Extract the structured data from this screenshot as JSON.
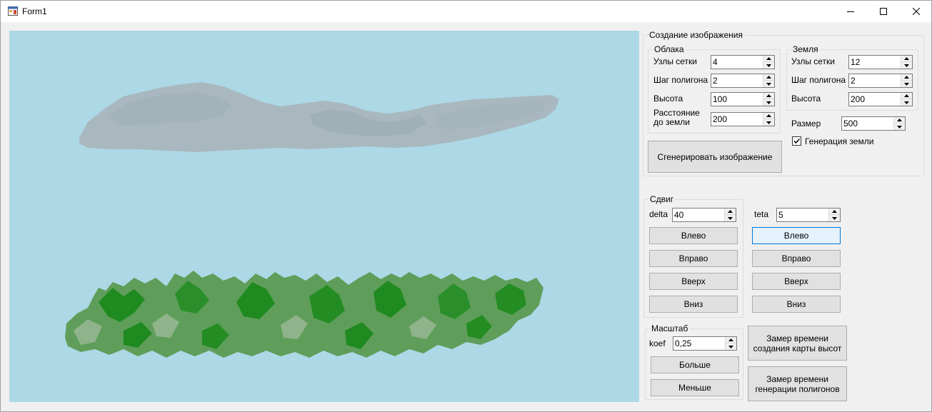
{
  "window": {
    "title": "Form1"
  },
  "creation": {
    "title": "Создание изображения",
    "clouds": {
      "title": "Облака",
      "grid_label": "Узлы сетки",
      "grid_value": "4",
      "step_label": "Шаг полигона",
      "step_value": "2",
      "height_label": "Высота",
      "height_value": "100",
      "distance_label": "Расстояние до земли",
      "distance_value": "200"
    },
    "earth": {
      "title": "Земля",
      "grid_label": "Узлы сетки",
      "grid_value": "12",
      "step_label": "Шаг полигона",
      "step_value": "2",
      "height_label": "Высота",
      "height_value": "200"
    },
    "size_label": "Размер",
    "size_value": "500",
    "generate_earth_label": "Генерация земли",
    "generate_earth_checked": true,
    "generate_button": "Сгенерировать изображение"
  },
  "shift": {
    "title": "Сдвиг",
    "delta_label": "delta",
    "delta_value": "40",
    "left": "Влево",
    "right": "Вправо",
    "up": "Вверх",
    "down": "Вниз"
  },
  "rotate": {
    "teta_label": "teta",
    "teta_value": "5",
    "left": "Влево",
    "right": "Вправо",
    "up": "Вверх",
    "down": "Вниз"
  },
  "scale": {
    "title": "Масштаб",
    "koef_label": "koef",
    "koef_value": "0,25",
    "bigger": "Больше",
    "smaller": "Меньше"
  },
  "timing": {
    "heightmap_button": "Замер времени создания карты высот",
    "polygons_button": "Замер времени генерации полигонов"
  },
  "colors": {
    "sky": "#add8e6",
    "cloud": "#a9b8bf",
    "cloud_dark": "#9aaab1",
    "earth": "#5f9e5a",
    "earth_dark": "#1f8a1f",
    "earth_light": "#8fb38a"
  }
}
